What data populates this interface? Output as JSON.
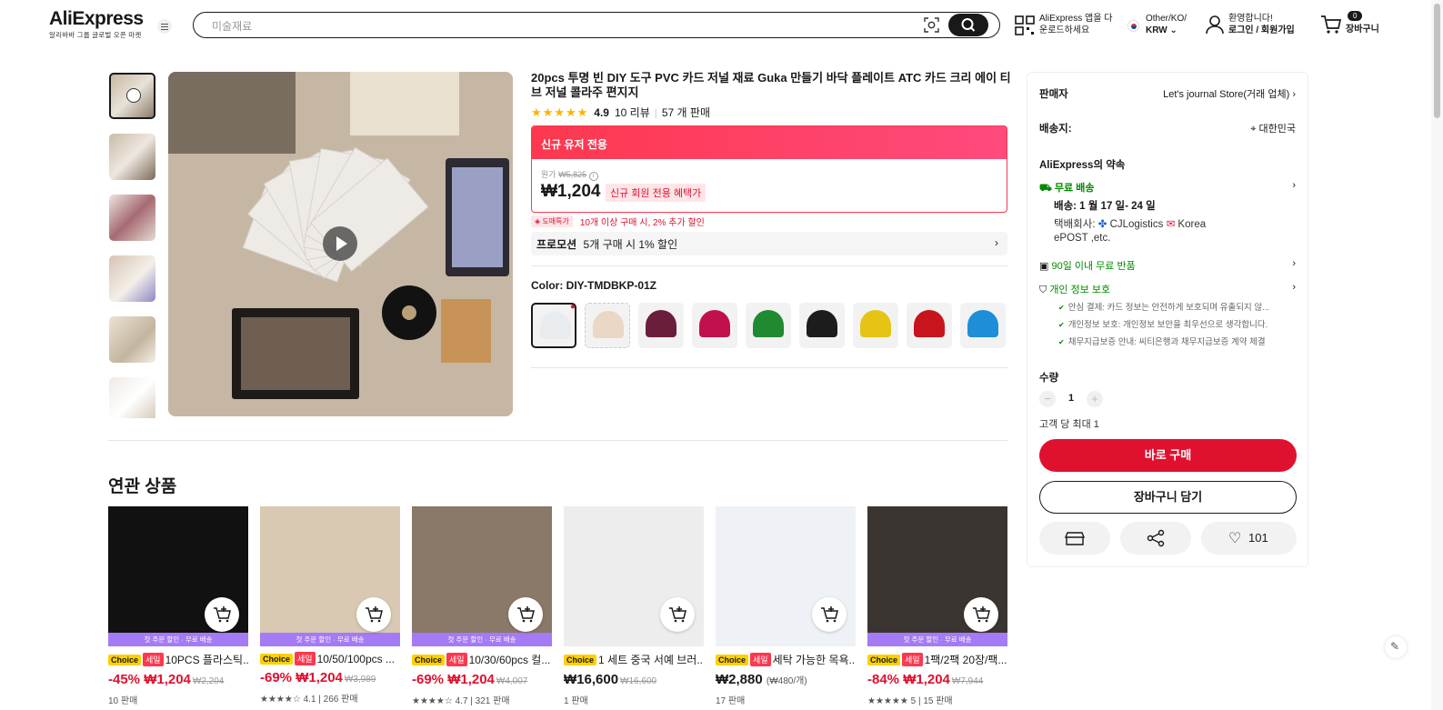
{
  "header": {
    "logo": "AliExpress",
    "logo_sub": "알리바바 그룹 글로벌 오픈 마켓",
    "search_placeholder": "미술재료",
    "app_line1": "AliExpress 앱을 다",
    "app_line2": "운로드하세요",
    "lang_line1": "Other/KO/",
    "lang_line2": "KRW",
    "user_line1": "환영합니다!",
    "user_line2": "로그인 / 회원가입",
    "cart_count": "0",
    "cart_label": "장바구니"
  },
  "product": {
    "title": "20pcs 투명 빈 DIY 도구 PVC 카드 저널 재료 Guka 만들기 바닥 플레이트 ATC 카드 크리 에이 티브 저널 콜라주 편지지",
    "rating": "4.9",
    "reviews": "10 리뷰",
    "sold": "57 개 판매",
    "promo_header": "신규 유저 전용",
    "orig_label": "원가",
    "orig_price": "₩5,825",
    "price": "₩1,204",
    "price_badge": "신규 회원 전용 혜택가",
    "bulk_tag": "도매특가",
    "bulk_text": "10개 이상 구매 시, 2% 추가 할인",
    "promotion_label": "프로모션",
    "promotion_text": "5개 구매 시 1% 할인",
    "color_label": "Color: DIY-TMDBKP-01Z",
    "swatch_colors": [
      "#e8ecef",
      "#ead8c4",
      "#6b1d3c",
      "#c2104e",
      "#1f8a30",
      "#1c1c1c",
      "#e5c414",
      "#c8141c",
      "#1e8ed8"
    ]
  },
  "related": {
    "title": "연관 상품",
    "first_order_banner": "첫 주문 할인 · 무료 배송",
    "choice": "Choice",
    "sale": "세일",
    "cards": [
      {
        "name": "10PCS 플라스틱...",
        "discount": "-45%",
        "price": "₩1,204",
        "orig": "₩2,204",
        "unit": "",
        "meta": "10 판매",
        "has_sale": true,
        "banner": true,
        "color": "#111"
      },
      {
        "name": "10/50/100pcs ...",
        "discount": "-69%",
        "price": "₩1,204",
        "orig": "₩3,989",
        "unit": "",
        "meta": "★★★★☆ 4.1 | 266 판매",
        "has_sale": true,
        "banner": true,
        "color": "#d9c9b3"
      },
      {
        "name": "10/30/60pcs 컬...",
        "discount": "-69%",
        "price": "₩1,204",
        "orig": "₩4,007",
        "unit": "",
        "meta": "★★★★☆ 4.7 | 321 판매",
        "has_sale": true,
        "banner": true,
        "color": "#8a7868"
      },
      {
        "name": "1 세트 중국 서예 브러...",
        "discount": "",
        "price": "₩16,600",
        "orig": "₩16,600",
        "unit": "",
        "meta": "1 판매",
        "has_sale": false,
        "banner": false,
        "color": "#ededed"
      },
      {
        "name": "세탁 가능한 목욕...",
        "discount": "",
        "price": "₩2,880",
        "orig": "",
        "unit": "(₩480/개)",
        "meta": "17 판매",
        "has_sale": true,
        "banner": false,
        "color": "#eef2f6"
      },
      {
        "name": "1팩/2팩 20장/팩...",
        "discount": "-84%",
        "price": "₩1,204",
        "orig": "₩7,944",
        "unit": "",
        "meta": "★★★★★ 5 | 15 판매",
        "has_sale": true,
        "banner": true,
        "color": "#3a3530"
      }
    ]
  },
  "panel": {
    "seller_label": "판매자",
    "seller_name": "Let's journal Store(거래 업체)",
    "ship_to_label": "배송지:",
    "ship_to": "대한민국",
    "promise_label": "AliExpress의 약속",
    "free_shipping": "무료 배송",
    "delivery": "배송: 1 월 17 일- 24 일",
    "carrier_line1": "택배회사:",
    "carrier_cj": "CJLogistics",
    "carrier_korea": "Korea",
    "carrier_line2": "ePOST ,etc.",
    "return_policy": "90일 이내 무료 반품",
    "privacy": "개인 정보 보호",
    "check1": "안심 결제: 카드 정보는 안전하게 보호되며 유출되지 않...",
    "check2": "개인정보 보호: 개인정보 보안을 최우선으로 생각합니다.",
    "check3": "채무지급보증 안내: 씨티은행과 채무지급보증 계약 체결",
    "qty_label": "수량",
    "qty_value": "1",
    "qty_limit": "고객 당 최대 1",
    "buy_now": "바로 구매",
    "add_to_cart": "장바구니 담기",
    "wishlist_count": "101"
  }
}
